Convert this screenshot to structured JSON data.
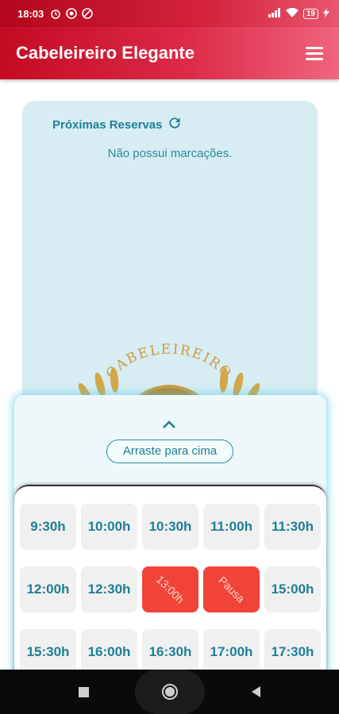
{
  "status_bar": {
    "time": "18:03",
    "battery": "19",
    "icons": [
      "alarm-icon",
      "vpn-icon",
      "data-saver-icon",
      "signal-icon",
      "wifi-icon",
      "battery-icon",
      "charging-icon"
    ]
  },
  "app_bar": {
    "title": "Cabeleireiro Elegante",
    "menu_icon": "hamburger-menu-icon"
  },
  "reservas": {
    "title": "Próximas Reservas",
    "refresh_icon": "refresh-icon",
    "empty_message": "Não possui marcações."
  },
  "logo": {
    "text": "CABELEIREIRO"
  },
  "sheet": {
    "drag_label": "Arraste para cima",
    "chevron_icon": "chevron-up-icon"
  },
  "slots": [
    {
      "label": "9:30h",
      "state": "available"
    },
    {
      "label": "10:00h",
      "state": "available"
    },
    {
      "label": "10:30h",
      "state": "available"
    },
    {
      "label": "11:00h",
      "state": "available"
    },
    {
      "label": "11:30h",
      "state": "available"
    },
    {
      "label": "12:00h",
      "state": "available"
    },
    {
      "label": "12:30h",
      "state": "available"
    },
    {
      "label": "13:00h",
      "state": "busy"
    },
    {
      "label": "Pausa",
      "state": "busy"
    },
    {
      "label": "15:00h",
      "state": "available"
    },
    {
      "label": "15:30h",
      "state": "available"
    },
    {
      "label": "16:00h",
      "state": "available"
    },
    {
      "label": "16:30h",
      "state": "available"
    },
    {
      "label": "17:00h",
      "state": "available"
    },
    {
      "label": "17:30h",
      "state": "available"
    }
  ],
  "colors": {
    "app_bar_start": "#c40a22",
    "app_bar_end": "#f0657e",
    "accent_teal": "#1f8196",
    "card_bg": "#d8ecf3",
    "busy_slot": "#f04438",
    "slot_bg": "#f0f0f0"
  },
  "nav": {
    "recent_icon": "recent-apps-icon",
    "home_icon": "home-icon",
    "back_icon": "back-icon"
  }
}
